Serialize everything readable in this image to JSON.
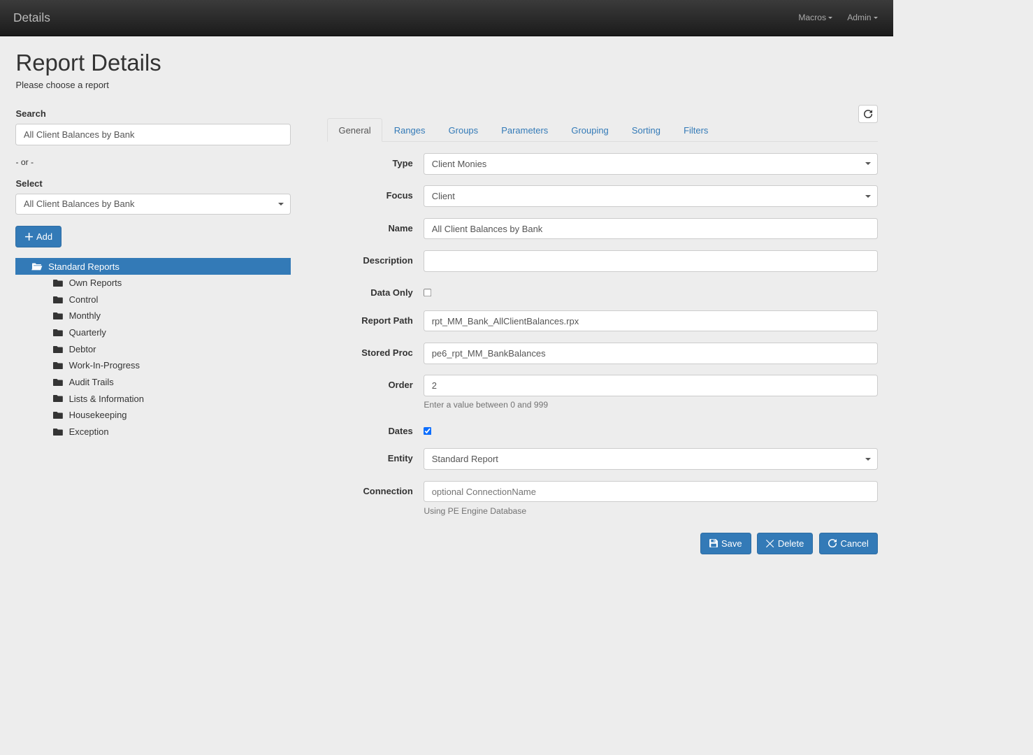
{
  "navbar": {
    "brand": "Details",
    "macros_label": "Macros",
    "admin_label": "Admin"
  },
  "header": {
    "title": "Report Details",
    "subtitle": "Please choose a report"
  },
  "left": {
    "search_label": "Search",
    "search_value": "All Client Balances by Bank",
    "or_text": "- or -",
    "select_label": "Select",
    "select_value": "All Client Balances by Bank",
    "add_label": "Add",
    "tree": {
      "root": "Standard Reports",
      "children": [
        "Own Reports",
        "Control",
        "Monthly",
        "Quarterly",
        "Debtor",
        "Work-In-Progress",
        "Audit Trails",
        "Lists & Information",
        "Housekeeping",
        "Exception"
      ]
    }
  },
  "tabs": {
    "general": "General",
    "ranges": "Ranges",
    "groups": "Groups",
    "parameters": "Parameters",
    "grouping": "Grouping",
    "sorting": "Sorting",
    "filters": "Filters"
  },
  "form": {
    "type_label": "Type",
    "type_value": "Client Monies",
    "focus_label": "Focus",
    "focus_value": "Client",
    "name_label": "Name",
    "name_value": "All Client Balances by Bank",
    "description_label": "Description",
    "description_value": "",
    "dataonly_label": "Data Only",
    "reportpath_label": "Report Path",
    "reportpath_value": "rpt_MM_Bank_AllClientBalances.rpx",
    "storedproc_label": "Stored Proc",
    "storedproc_value": "pe6_rpt_MM_BankBalances",
    "order_label": "Order",
    "order_value": "2",
    "order_help": "Enter a value between 0 and 999",
    "dates_label": "Dates",
    "entity_label": "Entity",
    "entity_value": "Standard Report",
    "connection_label": "Connection",
    "connection_placeholder": "optional ConnectionName",
    "connection_help": "Using PE Engine Database"
  },
  "buttons": {
    "save": "Save",
    "delete": "Delete",
    "cancel": "Cancel"
  }
}
